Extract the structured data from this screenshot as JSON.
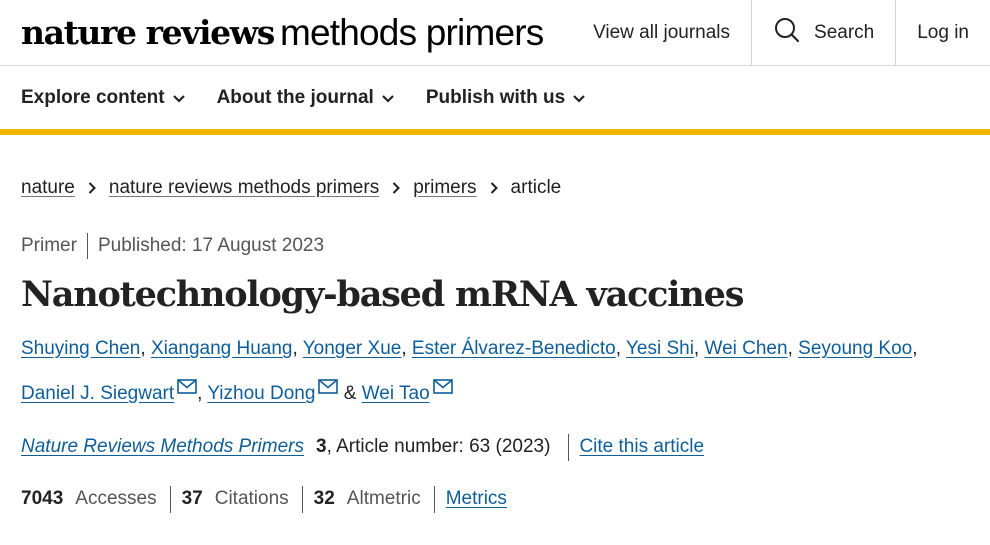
{
  "header": {
    "logo_bold": "nature reviews",
    "logo_light": "methods primers",
    "view_all": "View all journals",
    "search": "Search",
    "login": "Log in"
  },
  "subnav": {
    "explore": "Explore content",
    "about": "About the journal",
    "publish": "Publish with us"
  },
  "breadcrumb": {
    "items": [
      "nature",
      "nature reviews methods primers",
      "primers"
    ],
    "current": "article"
  },
  "article": {
    "type": "Primer",
    "published": "Published: 17 August 2023",
    "title": "Nanotechnology-based mRNA vaccines",
    "authors": [
      "Shuying Chen",
      "Xiangang Huang",
      "Yonger Xue",
      "Ester Álvarez-Benedicto",
      "Yesi Shi",
      "Wei Chen",
      "Seyoung Koo",
      "Daniel J. Siegwart",
      "Yizhou Dong",
      "Wei Tao"
    ],
    "comma": ",",
    "ampersand": "&",
    "journal": "Nature Reviews Methods Primers",
    "volume": "3",
    "article_number": ", Article number: 63 (2023)",
    "cite": "Cite this article"
  },
  "metrics": {
    "accesses_num": "7043",
    "accesses_label": "Accesses",
    "citations_num": "37",
    "citations_label": "Citations",
    "altmetric_num": "32",
    "altmetric_label": "Altmetric",
    "metrics_link": "Metrics"
  },
  "colors": {
    "accent_bar": "#f2b705",
    "link": "#0f5e99"
  }
}
